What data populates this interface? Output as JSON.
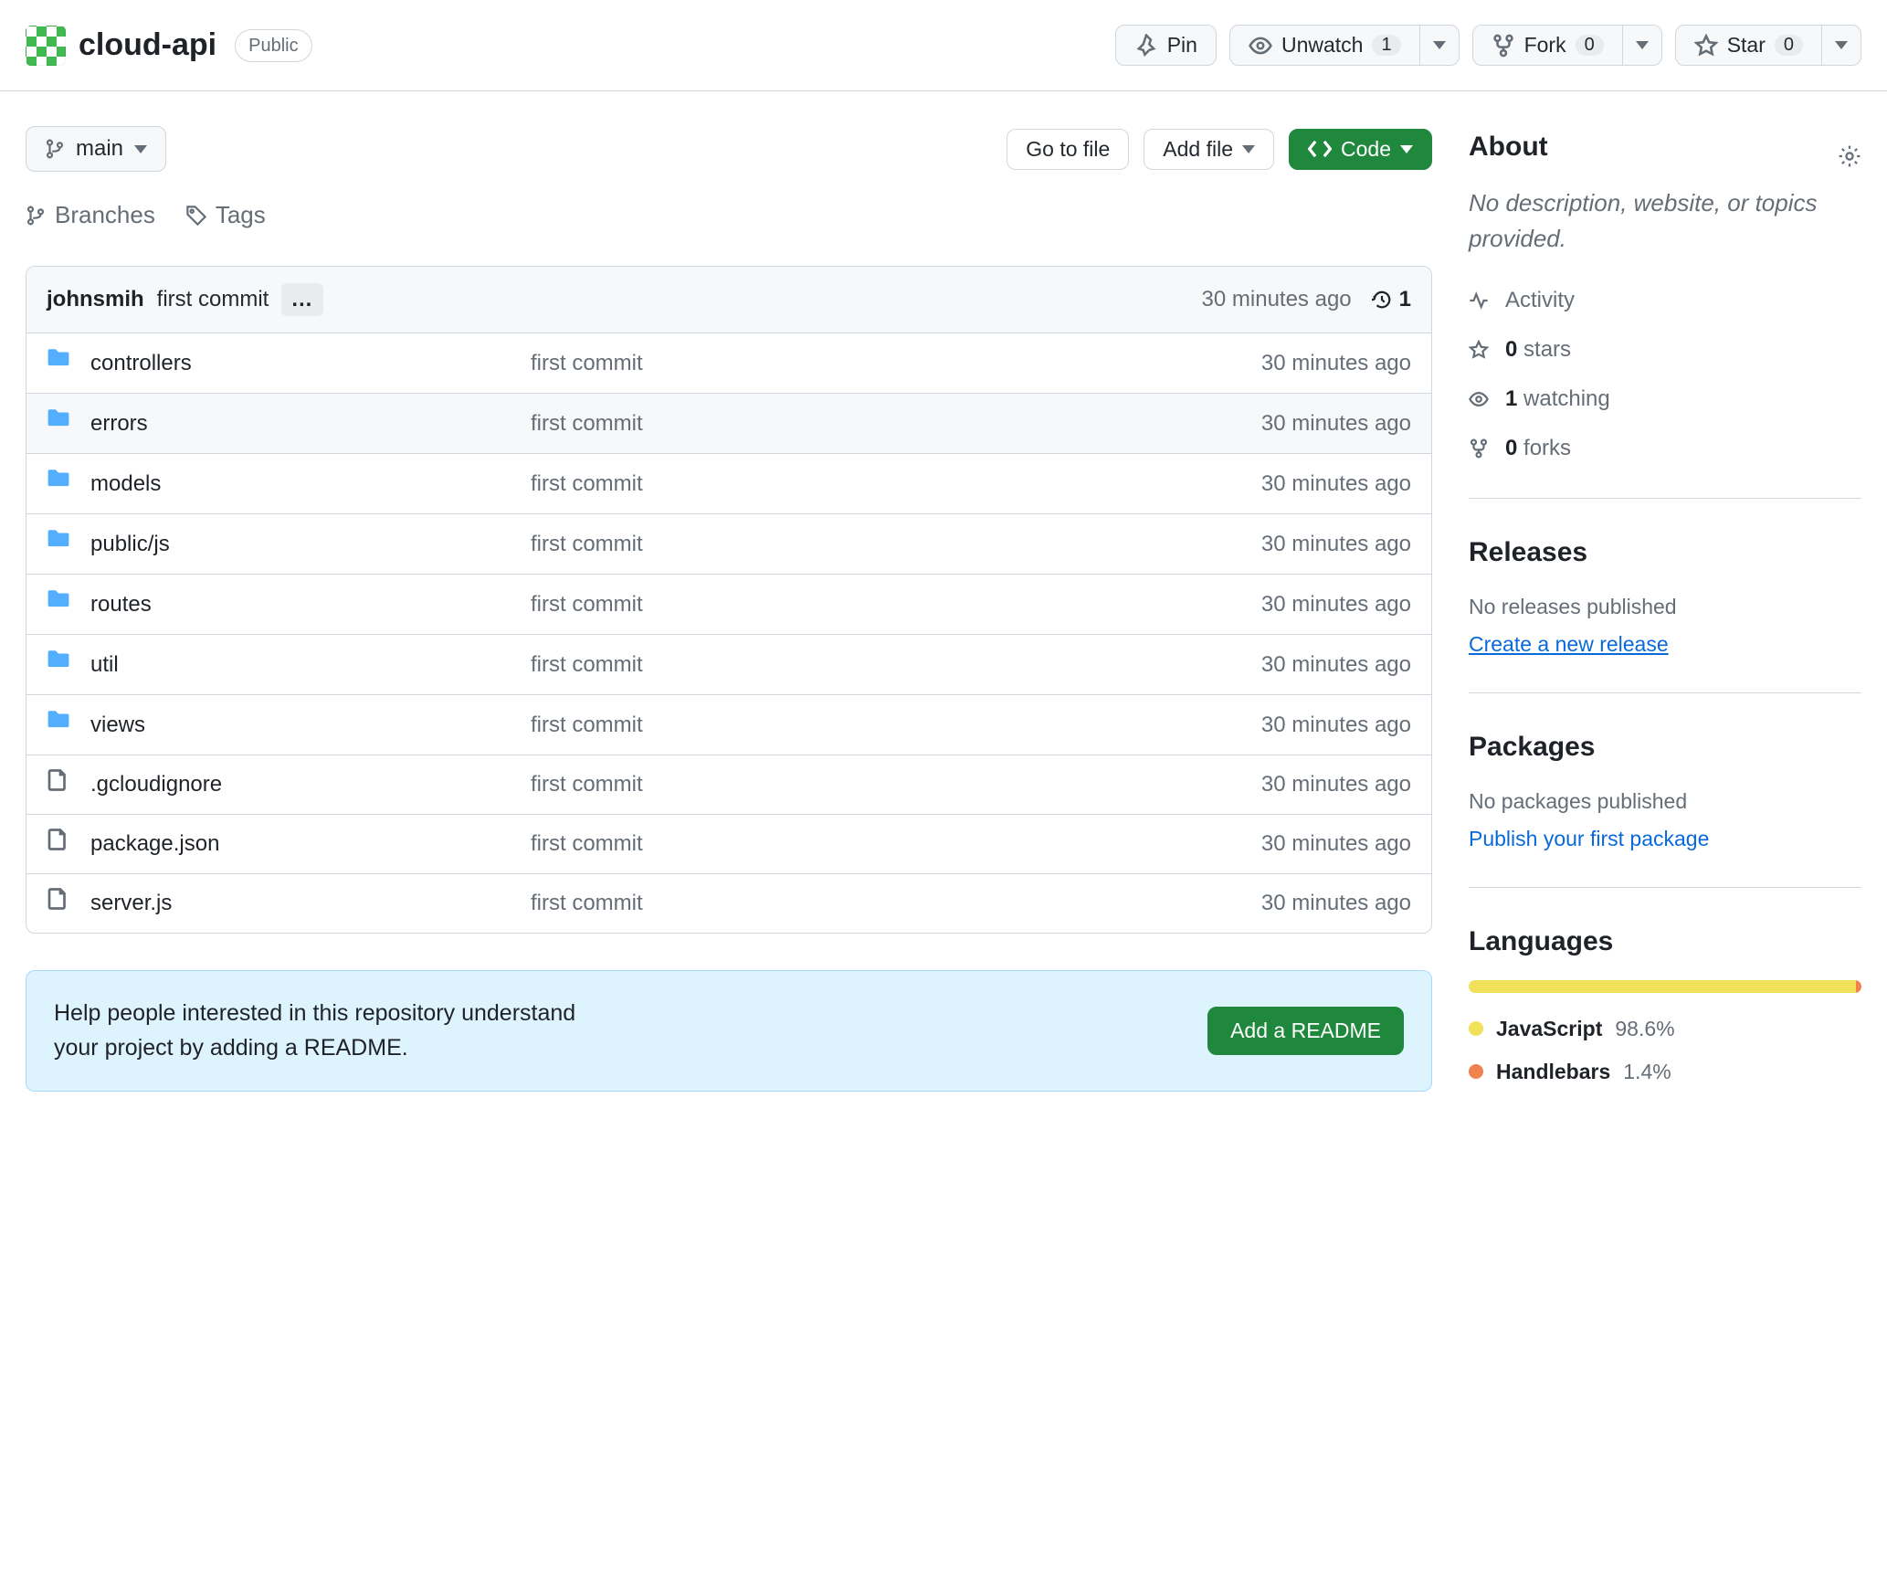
{
  "header": {
    "repo_name": "cloud-api",
    "visibility": "Public",
    "pin": "Pin",
    "unwatch": "Unwatch",
    "unwatch_count": "1",
    "fork": "Fork",
    "fork_count": "0",
    "star": "Star",
    "star_count": "0"
  },
  "toolbar": {
    "branch": "main",
    "go_to_file": "Go to file",
    "add_file": "Add file",
    "code": "Code",
    "branches": "Branches",
    "tags": "Tags"
  },
  "commit": {
    "author": "johnsmih",
    "message": "first commit",
    "time": "30 minutes ago",
    "count": "1"
  },
  "files": [
    {
      "type": "dir",
      "name": "controllers",
      "msg": "first commit",
      "time": "30 minutes ago",
      "hover": false
    },
    {
      "type": "dir",
      "name": "errors",
      "msg": "first commit",
      "time": "30 minutes ago",
      "hover": true
    },
    {
      "type": "dir",
      "name": "models",
      "msg": "first commit",
      "time": "30 minutes ago",
      "hover": false
    },
    {
      "type": "dir",
      "name": "public/js",
      "msg": "first commit",
      "time": "30 minutes ago",
      "hover": false
    },
    {
      "type": "dir",
      "name": "routes",
      "msg": "first commit",
      "time": "30 minutes ago",
      "hover": false
    },
    {
      "type": "dir",
      "name": "util",
      "msg": "first commit",
      "time": "30 minutes ago",
      "hover": false
    },
    {
      "type": "dir",
      "name": "views",
      "msg": "first commit",
      "time": "30 minutes ago",
      "hover": false
    },
    {
      "type": "file",
      "name": ".gcloudignore",
      "msg": "first commit",
      "time": "30 minutes ago",
      "hover": false
    },
    {
      "type": "file",
      "name": "package.json",
      "msg": "first commit",
      "time": "30 minutes ago",
      "hover": false
    },
    {
      "type": "file",
      "name": "server.js",
      "msg": "first commit",
      "time": "30 minutes ago",
      "hover": false
    }
  ],
  "readme": {
    "text": "Help people interested in this repository understand your project by adding a README.",
    "button": "Add a README"
  },
  "about": {
    "title": "About",
    "description": "No description, website, or topics provided.",
    "activity": "Activity",
    "stars_count": "0",
    "stars_label": "stars",
    "watching_count": "1",
    "watching_label": "watching",
    "forks_count": "0",
    "forks_label": "forks"
  },
  "releases": {
    "title": "Releases",
    "none": "No releases published",
    "link": "Create a new release"
  },
  "packages": {
    "title": "Packages",
    "none": "No packages published",
    "link": "Publish your first package"
  },
  "languages": {
    "title": "Languages",
    "items": [
      {
        "name": "JavaScript",
        "pct": "98.6%",
        "color": "#f1e05a",
        "width": 98.6
      },
      {
        "name": "Handlebars",
        "pct": "1.4%",
        "color": "#f0834d",
        "width": 1.4
      }
    ]
  }
}
